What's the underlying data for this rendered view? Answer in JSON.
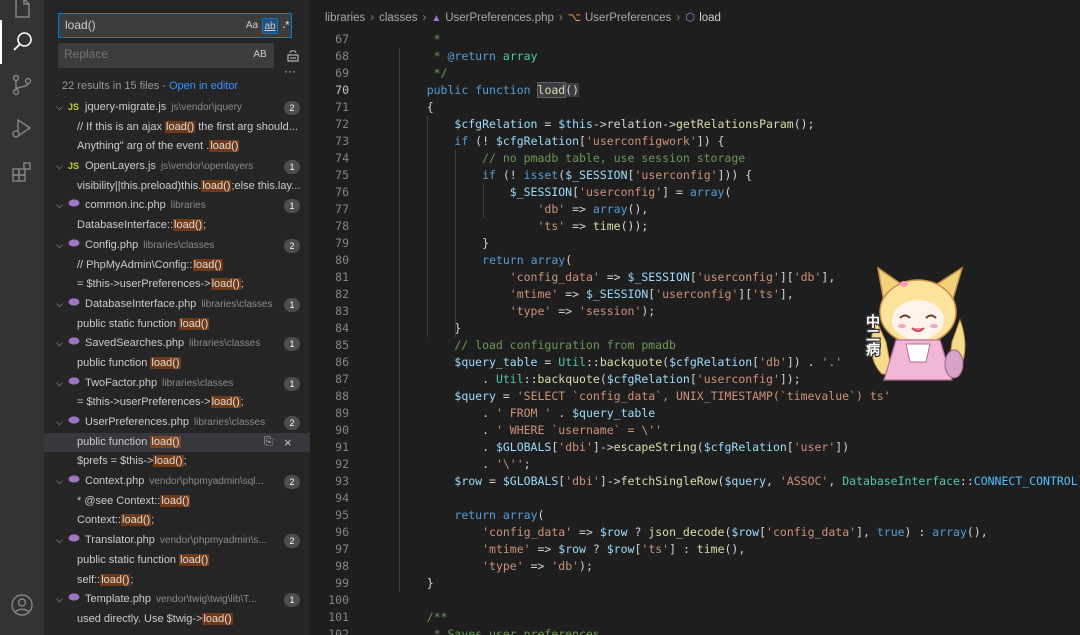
{
  "sidebar": {
    "search_value": "load()",
    "replace_placeholder": "Replace",
    "opt_case": "Aa",
    "opt_word": "ab",
    "opt_regex": ".*",
    "opt_preserve_case": "AB",
    "summary": "22 results in 15 files - ",
    "open_in_editor": "Open in editor",
    "more": "···"
  },
  "results": [
    {
      "kind": "file",
      "icon": "JS",
      "name": "jquery-migrate.js",
      "path": "js\\vendor\\jquery",
      "count": "2"
    },
    {
      "kind": "match",
      "pre": "// If this is an ajax ",
      "hl": "load()",
      "post": " the first arg should..."
    },
    {
      "kind": "match",
      "pre": "Anything\" arg of the event .",
      "hl": "load()",
      "post": ""
    },
    {
      "kind": "file",
      "icon": "JS",
      "name": "OpenLayers.js",
      "path": "js\\vendor\\openlayers",
      "count": "1"
    },
    {
      "kind": "match",
      "pre": "visibility||this.preload)this.",
      "hl": "load()",
      "post": ";else this.lay..."
    },
    {
      "kind": "file",
      "icon": "php",
      "name": "common.inc.php",
      "path": "libraries",
      "count": "1"
    },
    {
      "kind": "match",
      "pre": "DatabaseInterface::",
      "hl": "load()",
      "post": ";"
    },
    {
      "kind": "file",
      "icon": "php",
      "name": "Config.php",
      "path": "libraries\\classes",
      "count": "2"
    },
    {
      "kind": "match",
      "pre": "// PhpMyAdmin\\Config::",
      "hl": "load()",
      "post": ""
    },
    {
      "kind": "match",
      "pre": "= $this->userPreferences->",
      "hl": "load()",
      "post": ";"
    },
    {
      "kind": "file",
      "icon": "php",
      "name": "DatabaseInterface.php",
      "path": "libraries\\classes",
      "count": "1"
    },
    {
      "kind": "match",
      "pre": "public static function ",
      "hl": "load()",
      "post": ""
    },
    {
      "kind": "file",
      "icon": "php",
      "name": "SavedSearches.php",
      "path": "libraries\\classes",
      "count": "1"
    },
    {
      "kind": "match",
      "pre": "public function ",
      "hl": "load()",
      "post": ""
    },
    {
      "kind": "file",
      "icon": "php",
      "name": "TwoFactor.php",
      "path": "libraries\\classes",
      "count": "1"
    },
    {
      "kind": "match",
      "pre": "= $this->userPreferences->",
      "hl": "load()",
      "post": ";"
    },
    {
      "kind": "file",
      "icon": "php",
      "name": "UserPreferences.php",
      "path": "libraries\\classes",
      "count": "2"
    },
    {
      "kind": "match",
      "pre": "public function ",
      "hl": "load()",
      "post": "",
      "selected": true
    },
    {
      "kind": "match",
      "pre": "$prefs = $this->",
      "hl": "load()",
      "post": ";"
    },
    {
      "kind": "file",
      "icon": "php",
      "name": "Context.php",
      "path": "vendor\\phpmyadmin\\sql...",
      "count": "2"
    },
    {
      "kind": "match",
      "pre": "* @see Context::",
      "hl": "load()",
      "post": ""
    },
    {
      "kind": "match",
      "pre": "Context::",
      "hl": "load()",
      "post": ";"
    },
    {
      "kind": "file",
      "icon": "php",
      "name": "Translator.php",
      "path": "vendor\\phpmyadmin\\s...",
      "count": "2"
    },
    {
      "kind": "match",
      "pre": "public static function ",
      "hl": "load()",
      "post": ""
    },
    {
      "kind": "match",
      "pre": "self::",
      "hl": "load()",
      "post": ";"
    },
    {
      "kind": "file",
      "icon": "php",
      "name": "Template.php",
      "path": "vendor\\twig\\twig\\lib\\T...",
      "count": "1"
    },
    {
      "kind": "match",
      "pre": "used directly. Use $twig->",
      "hl": "load()",
      "post": ""
    }
  ],
  "breadcrumb": {
    "parts": [
      "libraries",
      "classes",
      "UserPreferences.php",
      "UserPreferences",
      "load"
    ]
  },
  "code": {
    "current_line": "70",
    "lines": [
      {
        "n": "67",
        "t": "     *"
      },
      {
        "n": "68",
        "t": "     * @return array"
      },
      {
        "n": "69",
        "t": "     */"
      },
      {
        "n": "70",
        "t": "    public function load()"
      },
      {
        "n": "71",
        "t": "    {"
      },
      {
        "n": "72",
        "t": "        $cfgRelation = $this->relation->getRelationsParam();"
      },
      {
        "n": "73",
        "t": "        if (! $cfgRelation['userconfigwork']) {"
      },
      {
        "n": "74",
        "t": "            // no pmadb table, use session storage"
      },
      {
        "n": "75",
        "t": "            if (! isset($_SESSION['userconfig'])) {"
      },
      {
        "n": "76",
        "t": "                $_SESSION['userconfig'] = array("
      },
      {
        "n": "77",
        "t": "                    'db' => array(),"
      },
      {
        "n": "78",
        "t": "                    'ts' => time());"
      },
      {
        "n": "79",
        "t": "            }"
      },
      {
        "n": "80",
        "t": "            return array("
      },
      {
        "n": "81",
        "t": "                'config_data' => $_SESSION['userconfig']['db'],"
      },
      {
        "n": "82",
        "t": "                'mtime' => $_SESSION['userconfig']['ts'],"
      },
      {
        "n": "83",
        "t": "                'type' => 'session');"
      },
      {
        "n": "84",
        "t": "        }"
      },
      {
        "n": "85",
        "t": "        // load configuration from pmadb"
      },
      {
        "n": "86",
        "t": "        $query_table = Util::backquote($cfgRelation['db']) . '.'"
      },
      {
        "n": "87",
        "t": "            . Util::backquote($cfgRelation['userconfig']);"
      },
      {
        "n": "88",
        "t": "        $query = 'SELECT `config_data`, UNIX_TIMESTAMP(`timevalue`) ts'"
      },
      {
        "n": "89",
        "t": "            . ' FROM ' . $query_table"
      },
      {
        "n": "90",
        "t": "            . ' WHERE `username` = \\''"
      },
      {
        "n": "91",
        "t": "            . $GLOBALS['dbi']->escapeString($cfgRelation['user'])"
      },
      {
        "n": "92",
        "t": "            . '\\'';"
      },
      {
        "n": "93",
        "t": "        $row = $GLOBALS['dbi']->fetchSingleRow($query, 'ASSOC', DatabaseInterface::CONNECT_CONTROL);"
      },
      {
        "n": "94",
        "t": ""
      },
      {
        "n": "95",
        "t": "        return array("
      },
      {
        "n": "96",
        "t": "            'config_data' => $row ? json_decode($row['config_data'], true) : array(),"
      },
      {
        "n": "97",
        "t": "            'mtime' => $row ? $row['ts'] : time(),"
      },
      {
        "n": "98",
        "t": "            'type' => 'db');"
      },
      {
        "n": "99",
        "t": "    }"
      },
      {
        "n": "100",
        "t": ""
      },
      {
        "n": "101",
        "t": "    /**"
      },
      {
        "n": "102",
        "t": "     * Saves user preferences"
      }
    ]
  },
  "mascot_text": "中二病",
  "colors": {
    "activitybar": "#333333",
    "sidebar": "#252526",
    "editor": "#1e1e1e",
    "accent": "#007fd4",
    "link": "#3794ff",
    "match_highlight": "#9e5a2c",
    "keyword": "#569cd6",
    "variable": "#9cdcfe",
    "string": "#ce9178",
    "comment": "#6a9955",
    "function": "#dcdcaa",
    "class": "#4ec9b0",
    "number": "#b5cea8"
  },
  "icons": [
    "files-icon",
    "search-icon",
    "source-control-icon",
    "run-debug-icon",
    "extensions-icon",
    "account-icon",
    "regex-icon",
    "case-icon",
    "whole-word-icon",
    "preserve-case-icon",
    "replace-all-icon",
    "php-file-icon",
    "js-file-icon",
    "chevron-down-icon",
    "symbol-class-icon",
    "symbol-method-icon",
    "replace-icon",
    "dismiss-icon"
  ]
}
